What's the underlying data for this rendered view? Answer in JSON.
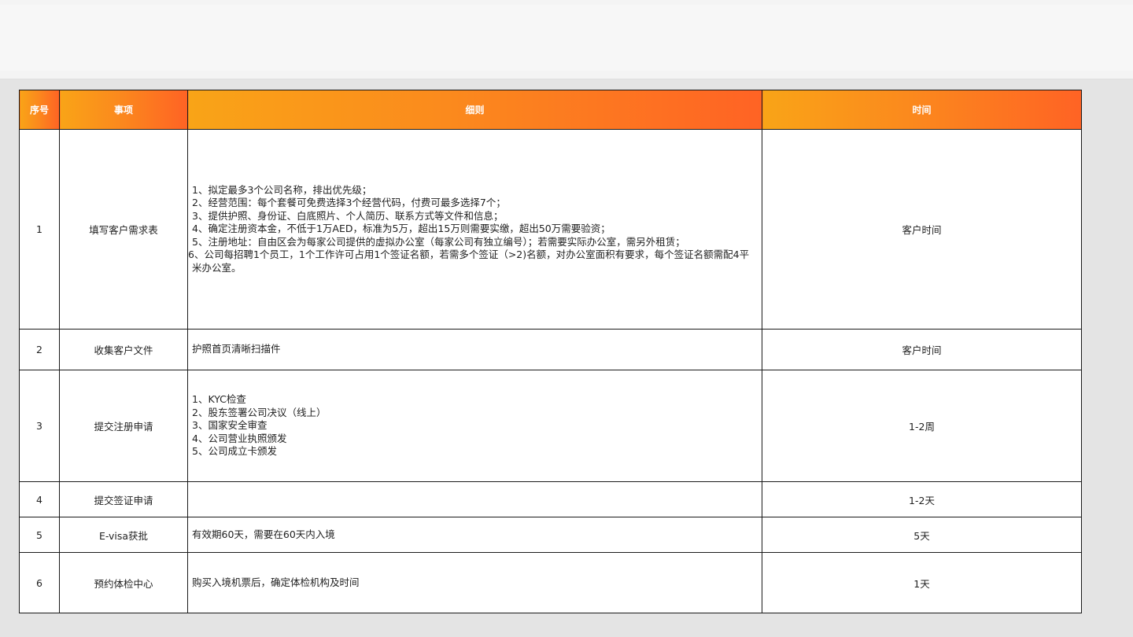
{
  "header": {
    "col_index": "序号",
    "col_item": "事项",
    "col_detail": "细则",
    "col_time": "时间"
  },
  "rows": [
    {
      "index": "1",
      "item": "填写客户需求表",
      "details": [
        "1、拟定最多3个公司名称，排出优先级；",
        "2、经营范围：每个套餐可免费选择3个经营代码，付费可最多选择7个；",
        "3、提供护照、身份证、白底照片、个人简历、联系方式等文件和信息；",
        "4、确定注册资本金，不低于1万AED，标准为5万，超出15万则需要实缴，超出50万需要验资；",
        "5、注册地址：自由区会为每家公司提供的虚拟办公室（每家公司有独立编号）；若需要实际办公室，需另外租赁；",
        "6、公司每招聘1个员工，1个工作许可占用1个签证名额，若需多个签证（>2)名额，对办公室面积有要求，每个签证名额需配4平米办公室。"
      ],
      "time": "客户时间"
    },
    {
      "index": "2",
      "item": "收集客户文件",
      "details": [
        "护照首页清晰扫描件"
      ],
      "time": "客户时间"
    },
    {
      "index": "3",
      "item": "提交注册申请",
      "details": [
        "1、KYC检查",
        "2、股东签署公司决议（线上）",
        "3、国家安全审查",
        "4、公司营业执照颁发",
        "5、公司成立卡颁发"
      ],
      "time": "1-2周"
    },
    {
      "index": "4",
      "item": "提交签证申请",
      "details": [],
      "time": "1-2天"
    },
    {
      "index": "5",
      "item": "E-visa获批",
      "details": [
        "有效期60天，需要在60天内入境"
      ],
      "time": "5天"
    },
    {
      "index": "6",
      "item": "预约体检中心",
      "details": [
        "购买入境机票后，确定体检机构及时间"
      ],
      "time": "1天"
    }
  ]
}
